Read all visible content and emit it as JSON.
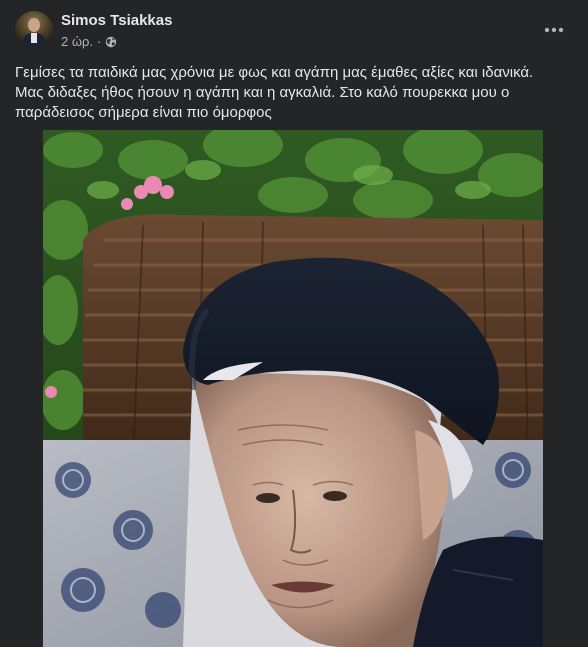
{
  "post": {
    "author": "Simos Tsiakkas",
    "timestamp": "2 ώρ.",
    "separator": "·",
    "privacy_icon": "globe-icon",
    "more_icon": "more-dots-icon",
    "text_lines": [
      "Γεμίσες τα παιδικά μας χρόνια με φως και αγάπη μας έμαθες αξίες και ιδανικά.",
      "Μας διδαξες ήθος  ήσουν η αγάπη και η αγκαλιά. Στο καλό πουρεκκα μου ο",
      "παράδεισος σήμερα είναι πιο όμορφος"
    ]
  },
  "colors": {
    "background": "#242526",
    "text_primary": "#e4e6eb",
    "text_secondary": "#b0b3b8"
  }
}
